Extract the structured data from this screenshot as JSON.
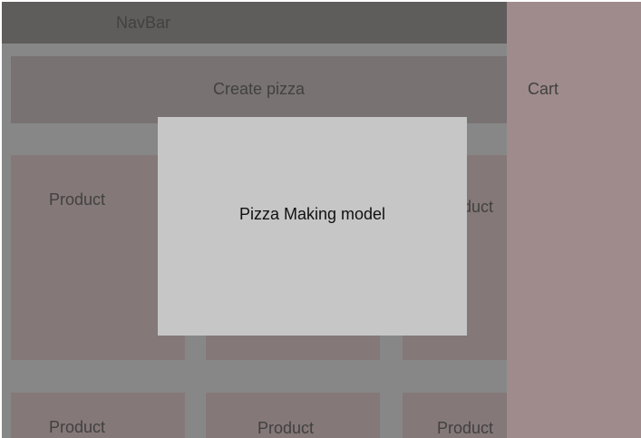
{
  "navbar": {
    "label": "NavBar"
  },
  "create_pizza": {
    "label": "Create pizza"
  },
  "cart": {
    "label": "Cart"
  },
  "products": [
    {
      "label": "Product"
    },
    {
      "label": ""
    },
    {
      "label": "Product"
    },
    {
      "label": "Product"
    },
    {
      "label": "Product"
    },
    {
      "label": "Product"
    }
  ],
  "modal": {
    "title": "Pizza Making model"
  },
  "colors": {
    "background": "#878787",
    "navbar": "#5f5c5c",
    "create_pizza": "#787272",
    "cart": "#9f8b8b",
    "product": "#857878",
    "modal": "#c6c6c6"
  }
}
